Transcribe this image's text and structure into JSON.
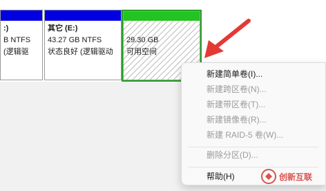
{
  "partitions": [
    {
      "title": ":)",
      "size": "B NTFS",
      "status": "(逻辑驱",
      "bar_color": "#0000e1"
    },
    {
      "title": "其它  (E:)",
      "size": "43.27 GB NTFS",
      "status": "状态良好 (逻辑驱动",
      "bar_color": "#0000e1"
    },
    {
      "title": "",
      "size": "29.30 GB",
      "status": "可用空间",
      "bar_color": "#22c322"
    }
  ],
  "menu": {
    "items": [
      {
        "label": "新建简单卷(I)...",
        "enabled": true
      },
      {
        "label": "新建跨区卷(N)...",
        "enabled": false
      },
      {
        "label": "新建带区卷(T)...",
        "enabled": false
      },
      {
        "label": "新建镜像卷(R)...",
        "enabled": false
      },
      {
        "label": "新建 RAID-5 卷(W)...",
        "enabled": false
      },
      {
        "label": "删除分区(D)...",
        "enabled": false
      },
      {
        "label": "帮助(H)",
        "enabled": true
      }
    ]
  },
  "watermark": {
    "text": "创新互联",
    "color": "#d9534f"
  },
  "colors": {
    "accent_red": "#e53935",
    "free_green": "#22c322",
    "primary_blue": "#0000e1"
  }
}
